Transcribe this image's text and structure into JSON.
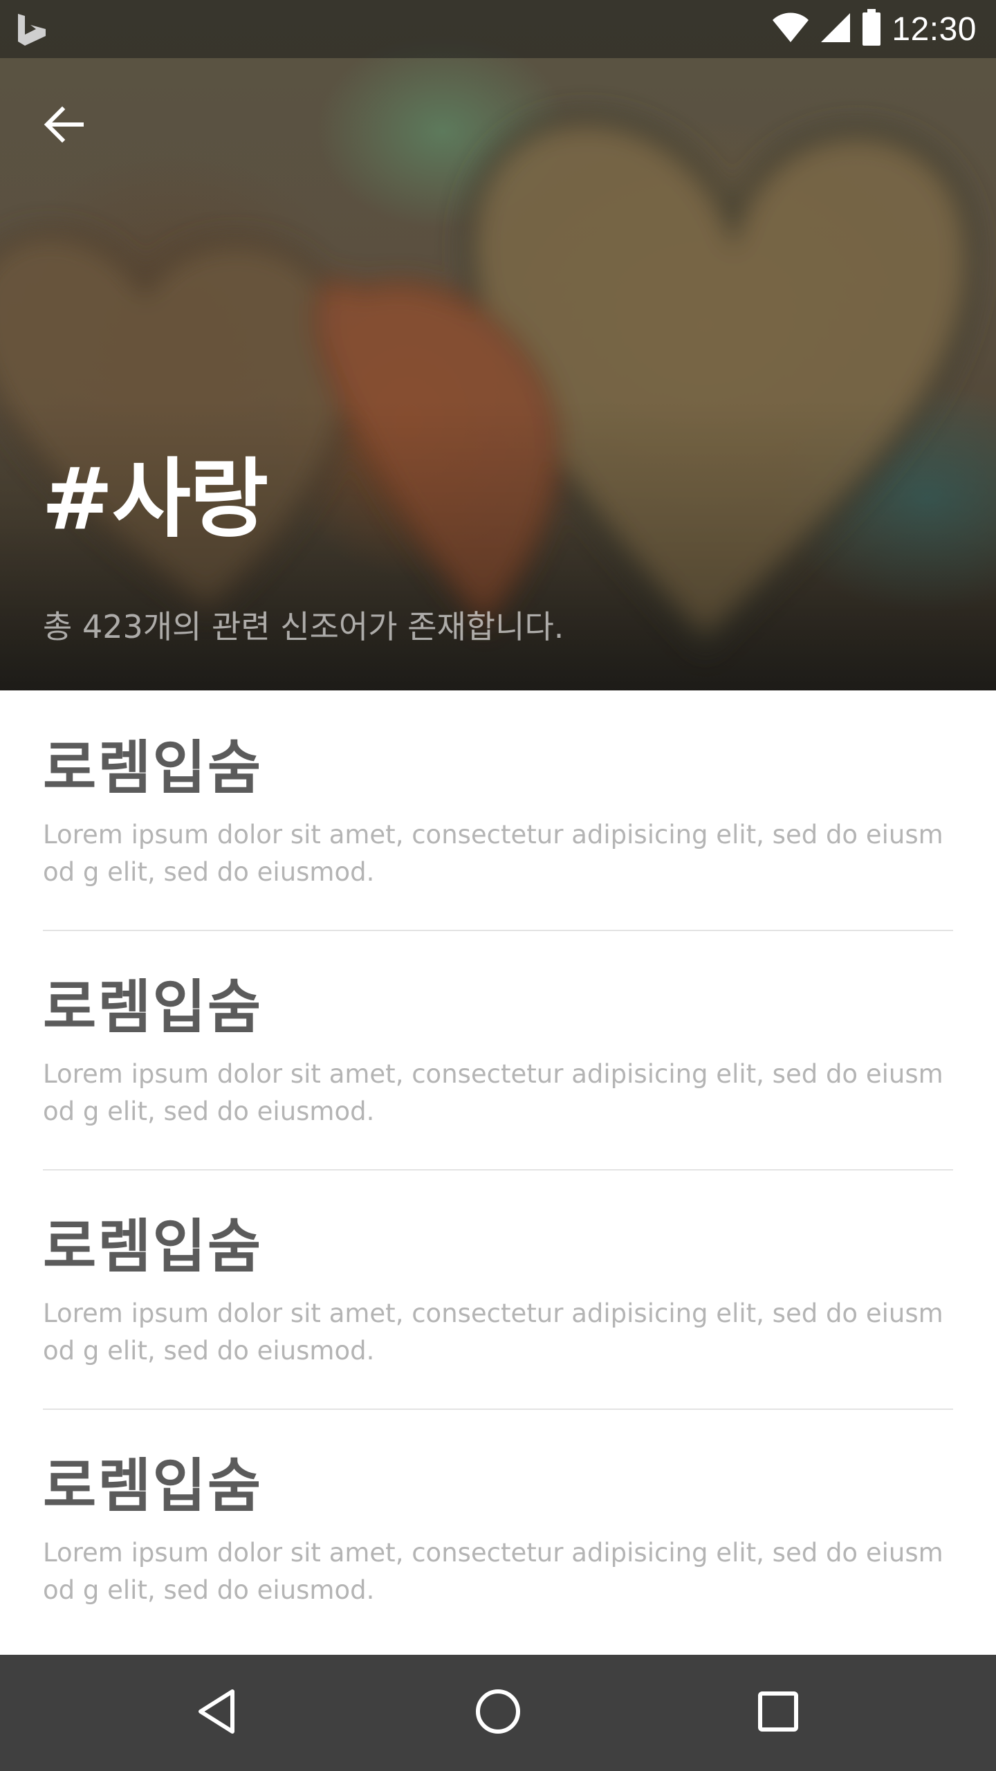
{
  "status_bar": {
    "time": "12:30",
    "icons": [
      "bing-logo-icon",
      "wifi-icon",
      "signal-icon",
      "battery-icon"
    ]
  },
  "header": {
    "back_icon": "arrow-left-icon",
    "title": "#사랑",
    "subtitle": "총 423개의 관련 신조어가 존재합니다."
  },
  "items": [
    {
      "title": "로렘입숨",
      "description": "Lorem ipsum dolor sit amet, consectetur adipisicing elit, sed do eiusmod g elit, sed do eiusmod."
    },
    {
      "title": "로렘입숨",
      "description": "Lorem ipsum dolor sit amet, consectetur adipisicing elit, sed do eiusmod g elit, sed do eiusmod."
    },
    {
      "title": "로렘입숨",
      "description": "Lorem ipsum dolor sit amet, consectetur adipisicing elit, sed do eiusmod g elit, sed do eiusmod."
    },
    {
      "title": "로렘입숨",
      "description": "Lorem ipsum dolor sit amet, consectetur adipisicing elit, sed do eiusmod g elit, sed do eiusmod."
    }
  ],
  "nav_bar": {
    "icons": [
      "nav-back-icon",
      "nav-home-icon",
      "nav-recents-icon"
    ]
  },
  "colors": {
    "title_text": "#5b5b5b",
    "description_text": "#b4b4b4",
    "divider": "#e3e3e3",
    "nav_bar": "#404040"
  }
}
